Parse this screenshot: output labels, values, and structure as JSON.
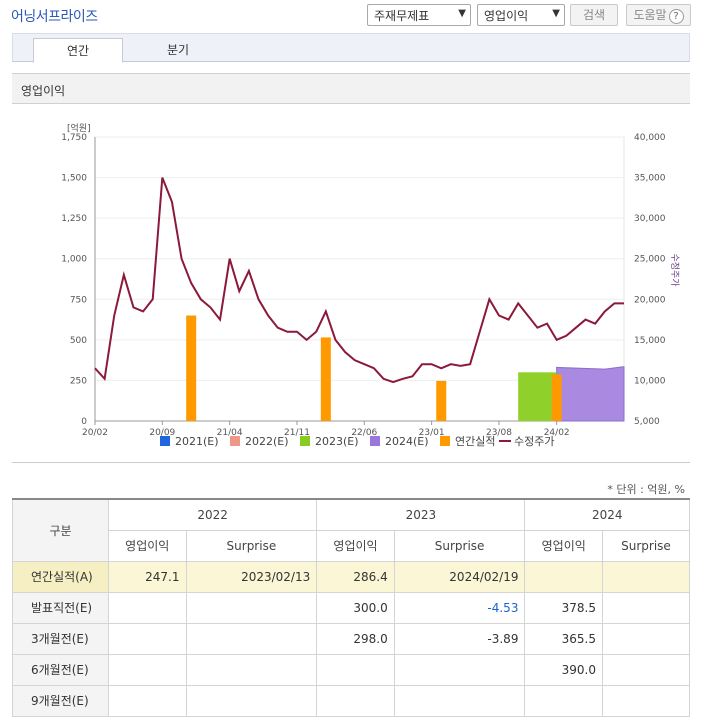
{
  "header": {
    "title": "어닝서프라이즈",
    "select1": "주재무제표",
    "select2": "영업이익",
    "search_label": "검색",
    "help_label": "도움말",
    "help_icon": "question-icon"
  },
  "tabs": [
    {
      "label": "연간"
    },
    {
      "label": "분기"
    }
  ],
  "section_title": "영업이익",
  "chart_data": {
    "type": "bar-line",
    "left_axis": {
      "label": "[억원]",
      "ticks": [
        "0",
        "250",
        "500",
        "750",
        "1,000",
        "1,250",
        "1,500",
        "1,750"
      ],
      "range": [
        0,
        1750
      ]
    },
    "right_axis": {
      "label": "수정주가",
      "ticks": [
        "5,000",
        "10,000",
        "15,000",
        "20,000",
        "25,000",
        "30,000",
        "35,000",
        "40,000"
      ],
      "range": [
        5000,
        40000
      ]
    },
    "x_ticks": [
      "20/02",
      "20/09",
      "21/04",
      "21/11",
      "22/06",
      "23/01",
      "23/08",
      "24/02"
    ],
    "legend": [
      {
        "name": "2021(E)",
        "color": "#2266dd"
      },
      {
        "name": "2022(E)",
        "color": "#ee9988"
      },
      {
        "name": "2023(E)",
        "color": "#88cc22"
      },
      {
        "name": "2024(E)",
        "color": "#9977dd"
      },
      {
        "name": "연간실적",
        "color": "#ff9900"
      },
      {
        "name": "수정주가",
        "color": "#8b1a3a"
      }
    ],
    "annual_actual": [
      {
        "x": "20/12",
        "value": 650
      },
      {
        "x": "22/02",
        "value": 515
      },
      {
        "x": "23/02",
        "value": 247
      },
      {
        "x": "24/02",
        "value": 286
      }
    ],
    "estimate_2023": 300,
    "estimate_2024": [
      {
        "x": "24/02",
        "value": 330
      },
      {
        "x": "24/07",
        "value": 320
      },
      {
        "x": "24/09",
        "value": 335
      }
    ],
    "price": [
      {
        "x": "20/02",
        "v": 11500
      },
      {
        "x": "20/03",
        "v": 10200
      },
      {
        "x": "20/04",
        "v": 18000
      },
      {
        "x": "20/05",
        "v": 23000
      },
      {
        "x": "20/06",
        "v": 19000
      },
      {
        "x": "20/07",
        "v": 18500
      },
      {
        "x": "20/08",
        "v": 20000
      },
      {
        "x": "20/09",
        "v": 35000
      },
      {
        "x": "20/10",
        "v": 32000
      },
      {
        "x": "20/11",
        "v": 25000
      },
      {
        "x": "20/12",
        "v": 22000
      },
      {
        "x": "21/01",
        "v": 20000
      },
      {
        "x": "21/02",
        "v": 19000
      },
      {
        "x": "21/03",
        "v": 17500
      },
      {
        "x": "21/04",
        "v": 25000
      },
      {
        "x": "21/05",
        "v": 21000
      },
      {
        "x": "21/06",
        "v": 23500
      },
      {
        "x": "21/07",
        "v": 20000
      },
      {
        "x": "21/08",
        "v": 18000
      },
      {
        "x": "21/09",
        "v": 16500
      },
      {
        "x": "21/10",
        "v": 16000
      },
      {
        "x": "21/11",
        "v": 16000
      },
      {
        "x": "21/12",
        "v": 15000
      },
      {
        "x": "22/01",
        "v": 16000
      },
      {
        "x": "22/02",
        "v": 18500
      },
      {
        "x": "22/03",
        "v": 15000
      },
      {
        "x": "22/04",
        "v": 13500
      },
      {
        "x": "22/05",
        "v": 12500
      },
      {
        "x": "22/06",
        "v": 12000
      },
      {
        "x": "22/07",
        "v": 11500
      },
      {
        "x": "22/08",
        "v": 10200
      },
      {
        "x": "22/09",
        "v": 9800
      },
      {
        "x": "22/10",
        "v": 10200
      },
      {
        "x": "22/11",
        "v": 10500
      },
      {
        "x": "22/12",
        "v": 12000
      },
      {
        "x": "23/01",
        "v": 12000
      },
      {
        "x": "23/02",
        "v": 11500
      },
      {
        "x": "23/03",
        "v": 12000
      },
      {
        "x": "23/04",
        "v": 11800
      },
      {
        "x": "23/05",
        "v": 12000
      },
      {
        "x": "23/06",
        "v": 16000
      },
      {
        "x": "23/07",
        "v": 20000
      },
      {
        "x": "23/08",
        "v": 18000
      },
      {
        "x": "23/09",
        "v": 17500
      },
      {
        "x": "23/10",
        "v": 19500
      },
      {
        "x": "23/11",
        "v": 18000
      },
      {
        "x": "23/12",
        "v": 16500
      },
      {
        "x": "24/01",
        "v": 17000
      },
      {
        "x": "24/02",
        "v": 15000
      },
      {
        "x": "24/03",
        "v": 15500
      },
      {
        "x": "24/04",
        "v": 16500
      },
      {
        "x": "24/05",
        "v": 17500
      },
      {
        "x": "24/06",
        "v": 17000
      },
      {
        "x": "24/07",
        "v": 18500
      },
      {
        "x": "24/08",
        "v": 19500
      },
      {
        "x": "24/09",
        "v": 19500
      }
    ]
  },
  "unit_note": "* 단위 : 억원, %",
  "table": {
    "corner": "구분",
    "years": [
      "2022",
      "2023",
      "2024"
    ],
    "sub_headers": [
      "영업이익",
      "Surprise",
      "영업이익",
      "Surprise",
      "영업이익",
      "Surprise"
    ],
    "rows": [
      {
        "label": "연간실적(A)",
        "cells": [
          "247.1",
          "2023/02/13",
          "286.4",
          "2024/02/19",
          "",
          ""
        ]
      },
      {
        "label": "발표직전(E)",
        "cells": [
          "",
          "",
          "300.0",
          "-4.53",
          "378.5",
          ""
        ]
      },
      {
        "label": "3개월전(E)",
        "cells": [
          "",
          "",
          "298.0",
          "-3.89",
          "365.5",
          ""
        ]
      },
      {
        "label": "6개월전(E)",
        "cells": [
          "",
          "",
          "",
          "",
          "390.0",
          ""
        ]
      },
      {
        "label": "9개월전(E)",
        "cells": [
          "",
          "",
          "",
          "",
          "",
          ""
        ]
      }
    ]
  }
}
